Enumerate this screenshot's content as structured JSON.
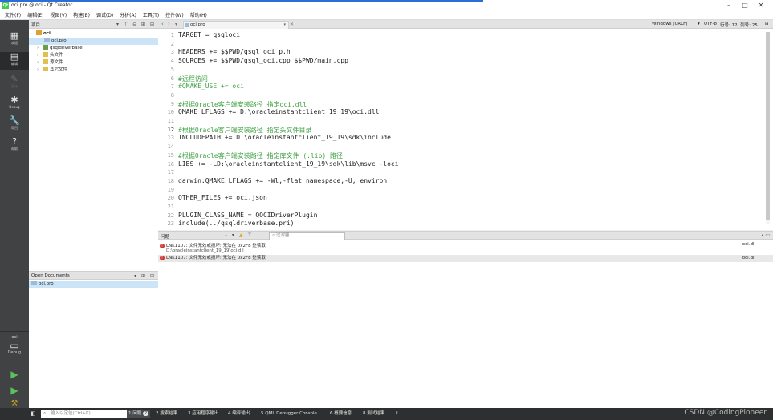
{
  "window": {
    "title": "oci.pro @ oci - Qt Creator",
    "app_icon": "Qt",
    "controls": {
      "minimize": "–",
      "maximize": "□",
      "close": "✕"
    }
  },
  "menu": [
    "文件(F)",
    "编辑(E)",
    "视图(V)",
    "构建(B)",
    "调试(D)",
    "分析(A)",
    "工具(T)",
    "控件(W)",
    "帮助(H)"
  ],
  "modes": [
    {
      "label": "欢迎",
      "icon": "grid-icon"
    },
    {
      "label": "编辑",
      "icon": "edit-icon",
      "active": true
    },
    {
      "label": "设计",
      "icon": "pen-icon",
      "disabled": true
    },
    {
      "label": "Debug",
      "icon": "bug-icon"
    },
    {
      "label": "项目",
      "icon": "wrench-icon"
    },
    {
      "label": "帮助",
      "icon": "help-icon"
    }
  ],
  "kit": {
    "project": "oci",
    "build": "Debug"
  },
  "project_panel": {
    "title": "项目",
    "tree": [
      {
        "label": "oci",
        "level": 0,
        "expanded": true,
        "bold": true
      },
      {
        "label": "oci.pro",
        "level": 1,
        "selected": true
      },
      {
        "label": "qsqldriverbase",
        "level": 1
      },
      {
        "label": "头文件",
        "level": 1
      },
      {
        "label": "源文件",
        "level": 1
      },
      {
        "label": "其它文件",
        "level": 1
      }
    ]
  },
  "open_documents": {
    "title": "Open Documents",
    "items": [
      "oci.pro"
    ]
  },
  "editor_toolbar": {
    "file": "oci.pro",
    "line_endings": "Windows (CRLF)",
    "encoding": "UTF-8",
    "position": "行号: 12, 列号: 25"
  },
  "editor": {
    "current_line": 12,
    "lines": [
      "TARGET = qsqloci",
      "",
      "HEADERS += $$PWD/qsql_oci_p.h",
      "SOURCES += $$PWD/qsql_oci.cpp $$PWD/main.cpp",
      "",
      "#远程访问",
      "#QMAKE_USE += oci",
      "",
      "#根据Oracle客户端安装路径 指定oci.dll",
      "QMAKE_LFLAGS += D:\\oracleinstantclient_19_19\\oci.dll",
      "",
      "#根据Oracle客户端安装路径 指定头文件目录",
      "INCLUDEPATH += D:\\oracleinstantclient_19_19\\sdk\\include",
      "",
      "#根据Oracle客户端安装路径 指定库文件 (.lib) 路径",
      "LIBS += -LD:\\oracleinstantclient_19_19\\sdk\\lib\\msvc -loci",
      "",
      "darwin:QMAKE_LFLAGS += -Wl,-flat_namespace,-U,_environ",
      "",
      "OTHER_FILES += oci.json",
      "",
      "PLUGIN_CLASS_NAME = QOCIDriverPlugin",
      "include(../qsqldriverbase.pri)"
    ]
  },
  "issues": {
    "title": "问题",
    "filter_placeholder": "过滤器",
    "items": [
      {
        "message": "LNK1107: 文件无效或损坏: 无法在 0x2F8 处读取",
        "detail": "D:\\oracleinstantclient_19_19\\oci.dll",
        "file": "oci.dll"
      },
      {
        "message": "LNK1107: 文件无效或损坏: 无法在 0x2F8 处读取",
        "detail": "",
        "file": "oci.dll"
      }
    ]
  },
  "bottom_bar": {
    "locator_placeholder": "输入以定位(Ctrl+K)",
    "panes": [
      {
        "label": "1 问题",
        "badge": "2",
        "active": true
      },
      {
        "label": "2 搜索结果"
      },
      {
        "label": "3 应用程序输出"
      },
      {
        "label": "4 编译输出"
      },
      {
        "label": "5 QML Debugger Console"
      },
      {
        "label": "6 概要信息"
      },
      {
        "label": "8 测试结果"
      },
      {
        "label": "⇕"
      }
    ],
    "watermark": "CSDN @CodingPioneer"
  }
}
